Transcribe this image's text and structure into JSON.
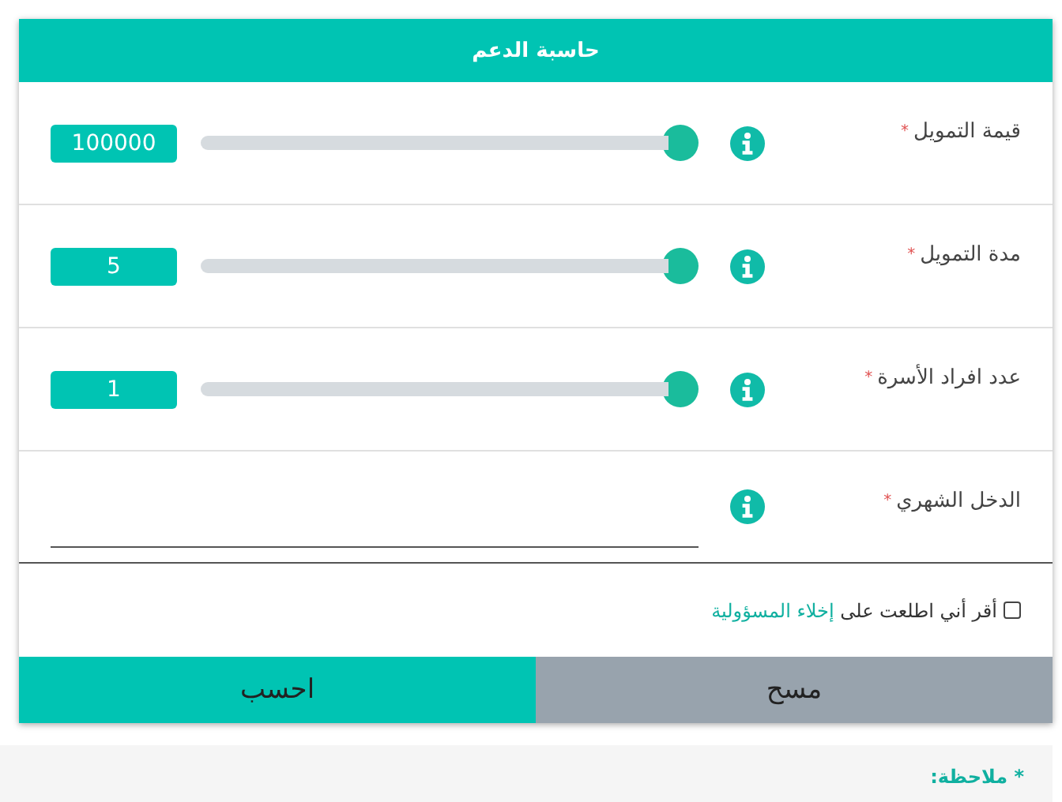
{
  "header": {
    "title": "حاسبة الدعم"
  },
  "fields": [
    {
      "kind": "slider",
      "label": "قيمة التمويل",
      "mark": "*",
      "value": "100000"
    },
    {
      "kind": "slider",
      "label": "مدة التمويل",
      "mark": "*",
      "value": "5"
    },
    {
      "kind": "slider",
      "label": "عدد افراد الأسرة",
      "mark": "*",
      "value": "1"
    },
    {
      "kind": "input",
      "label": "الدخل الشهري",
      "mark": "*"
    }
  ],
  "agreement": {
    "checked": false,
    "text": "أقر أني اطلعت على",
    "link": "إخلاء المسؤولية"
  },
  "buttons": [
    {
      "label": "مسح",
      "kind": "clear"
    },
    {
      "label": "احسب",
      "kind": "submit"
    }
  ],
  "note": {
    "label": "* ملاحظة:"
  }
}
